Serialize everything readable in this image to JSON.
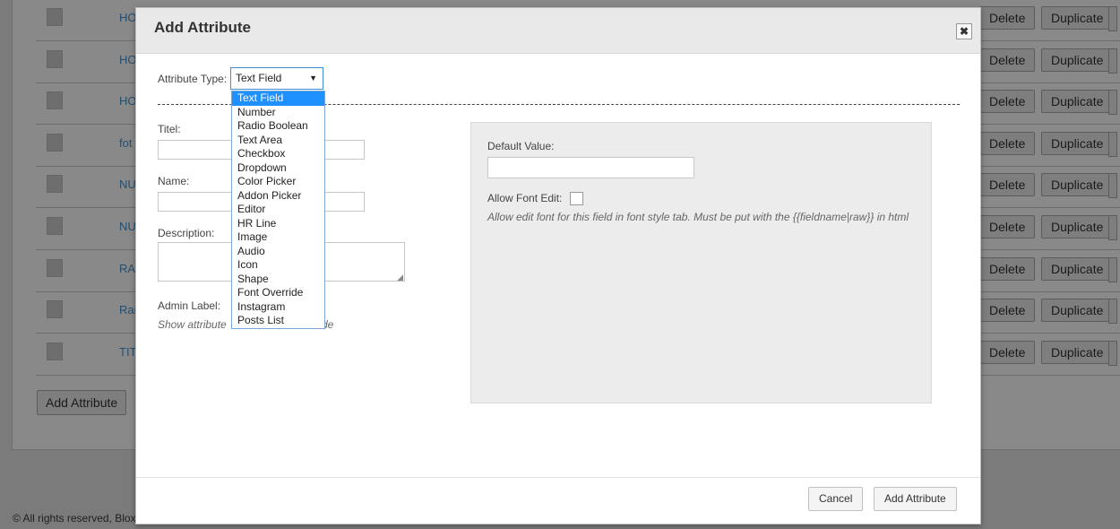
{
  "background": {
    "rows": [
      {
        "name": "HO",
        "delete": "Delete",
        "duplicate": "Duplicate"
      },
      {
        "name": "HO",
        "delete": "Delete",
        "duplicate": "Duplicate"
      },
      {
        "name": "HO",
        "delete": "Delete",
        "duplicate": "Duplicate"
      },
      {
        "name": "fot",
        "delete": "Delete",
        "duplicate": "Duplicate"
      },
      {
        "name": "NU",
        "delete": "Delete",
        "duplicate": "Duplicate"
      },
      {
        "name": "NU",
        "delete": "Delete",
        "duplicate": "Duplicate"
      },
      {
        "name": "RA",
        "delete": "Delete",
        "duplicate": "Duplicate"
      },
      {
        "name": "Ran",
        "delete": "Delete",
        "duplicate": "Duplicate"
      },
      {
        "name": "TIT",
        "delete": "Delete",
        "duplicate": "Duplicate"
      }
    ],
    "add_attribute_label": "Add Attribute",
    "footer_text": "© All rights reserved, Blox"
  },
  "modal": {
    "title": "Add Attribute",
    "close_icon": "close-icon",
    "attribute_type_label": "Attribute Type:",
    "attribute_type_value": "Text Field",
    "attribute_type_options": [
      "Text Field",
      "Number",
      "Radio Boolean",
      "Text Area",
      "Checkbox",
      "Dropdown",
      "Color Picker",
      "Addon Picker",
      "Editor",
      "HR Line",
      "Image",
      "Audio",
      "Icon",
      "Shape",
      "Font Override",
      "Instagram",
      "Posts List"
    ],
    "title_label": "Titel:",
    "name_label": "Name:",
    "description_label": "Description:",
    "admin_label_label": "Admin Label:",
    "admin_label_hint": "Show attribute",
    "admin_label_hint_tail": "de",
    "default_value_label": "Default Value:",
    "allow_font_edit_label": "Allow Font Edit:",
    "allow_font_edit_hint": "Allow edit font for this field in font style tab. Must be put with the {{fieldname|raw}} in html",
    "cancel_label": "Cancel",
    "submit_label": "Add Attribute"
  },
  "colors": {
    "accent": "#1e90ff",
    "overlay": "#7b7b7b"
  }
}
